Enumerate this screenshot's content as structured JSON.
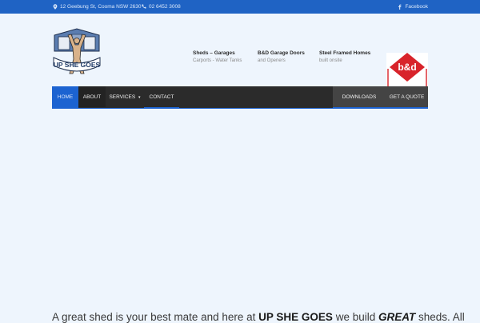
{
  "topbar": {
    "address": "12 Geebung St, Cooma NSW 2630",
    "phone": "02 6452 3008",
    "facebook": "Facebook",
    "address_icon": "location-pin-icon",
    "phone_icon": "phone-icon",
    "facebook_icon": "facebook-icon"
  },
  "logo": {
    "text": "UP SHE GOES"
  },
  "services": [
    {
      "title": "Sheds – Garages",
      "subtitle": "Carports - Water Tanks"
    },
    {
      "title": "B&D Garage Doors",
      "subtitle": "and Openers"
    },
    {
      "title": "Steel Framed Homes",
      "subtitle": "built onsite"
    }
  ],
  "bd_logo": {
    "text": "b&d"
  },
  "nav": {
    "home": "Home",
    "about": "About",
    "services": "Services",
    "contact": "Contact",
    "downloads": "Downloads",
    "quote": "Get a Quote"
  },
  "intro": {
    "part1": "A great shed is your best mate and here at ",
    "brand": "UP SHE GOES",
    "part2": " we build ",
    "great": "GREAT",
    "part3": " sheds. All"
  },
  "colors": {
    "topbar": "#1f63c4",
    "accent": "#1c63d1",
    "nav_bg": "#2b2b2b",
    "page_bg": "#eef5fd",
    "bd_red": "#d8232a"
  }
}
